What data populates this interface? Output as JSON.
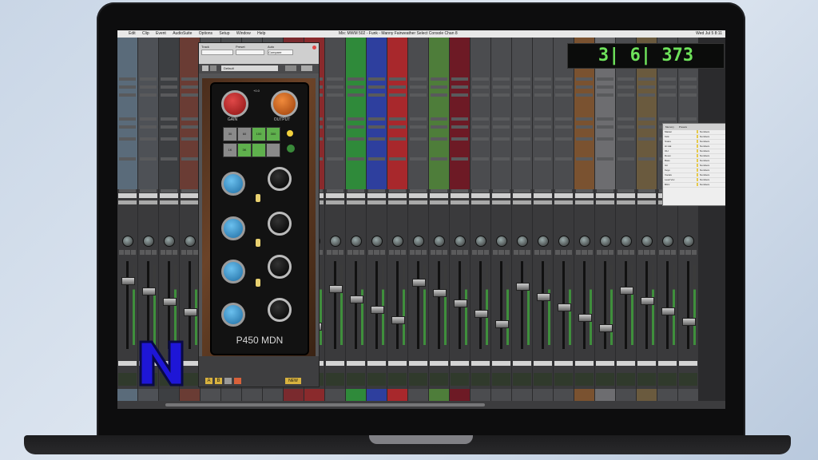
{
  "menu": {
    "items": [
      "Edit",
      "Clip",
      "Event",
      "AudioSuite",
      "Options",
      "Setup",
      "Window",
      "Help"
    ],
    "window_title": "Mix: MWM 502 - Funk - Manny Fairweather Select Console Chan 8",
    "clock": "Wed Jul 5 8:11"
  },
  "counter": "3| 6| 373",
  "plugin": {
    "labels": {
      "track": "Track",
      "preset": "Preset",
      "auto": "Auto"
    },
    "track_value": "Compare",
    "preset_value": "Default",
    "knobs": {
      "gain": "GAIN",
      "output": "OUTPUT"
    },
    "gain_db": "+0.0",
    "name": "P450 MDN",
    "switches": [
      "30",
      "60",
      "100",
      "300",
      "1K",
      "3K"
    ],
    "ab": [
      "A",
      "B"
    ],
    "new_label": "NEW"
  },
  "manager": {
    "tabs": [
      "Memory",
      "Presets"
    ],
    "rows": [
      "Master",
      "Kick",
      "Snare",
      "Hi Hat",
      "OH",
      "Room",
      "Bass",
      "Gtr",
      "Keys",
      "Vocals",
      "Lead Vox",
      "BGV"
    ],
    "tag": "Numbers"
  },
  "colors": {
    "accent": "#6ee25b",
    "logo": "#1e16d6",
    "strips": [
      "#5a6b7a",
      "#4e5156",
      "#3d3f42",
      "#6a3c34",
      "#4e4f52",
      "#4a4b4e",
      "#4b4c4f",
      "#4a4b4e",
      "#7a2a2e",
      "#8a2a2c",
      "#4b4c4f",
      "#2f8a3a",
      "#2e3f9e",
      "#a8282c",
      "#4b4c4f",
      "#4e7d3a",
      "#6d1a25",
      "#4b4c4f",
      "#4b4c4f",
      "#4b4c4f",
      "#4b4c4f",
      "#4b4c4f",
      "#7a5230",
      "#6d6d70",
      "#4b4c4f",
      "#6a5a3e",
      "#4b4c4f",
      "#4b4c4f"
    ]
  },
  "icons": [
    "close-icon",
    "link-icon",
    "compare-icon",
    "record-icon"
  ]
}
